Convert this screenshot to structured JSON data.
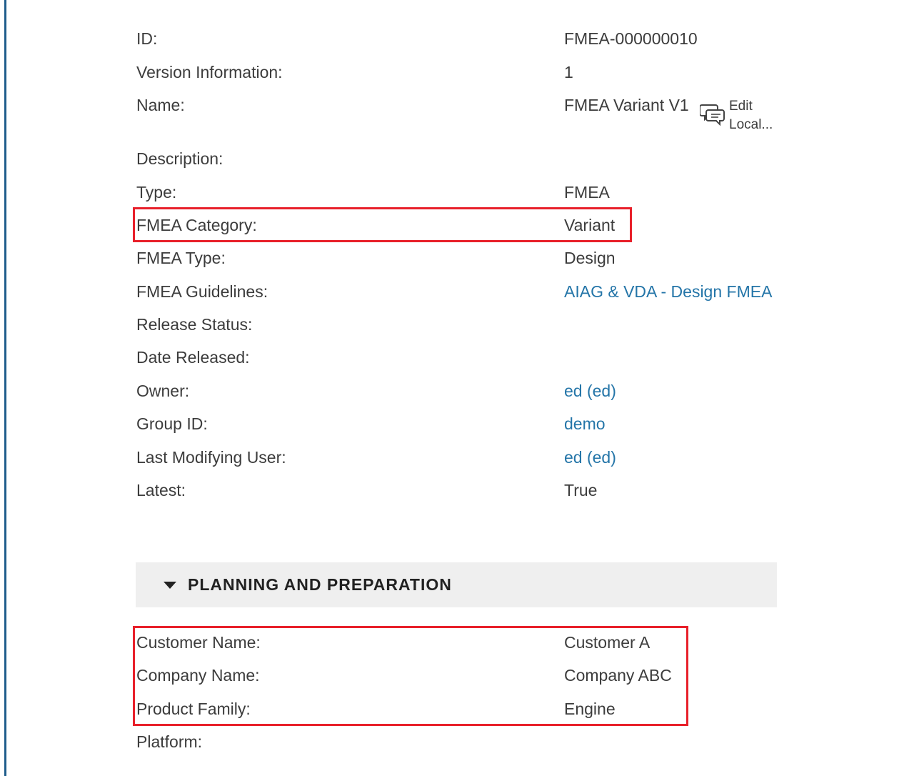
{
  "properties": [
    {
      "label": "ID:",
      "value": "FMEA-000000010",
      "link": false
    },
    {
      "label": "Version Information:",
      "value": "1",
      "link": false
    },
    {
      "label": "Name:",
      "value": "FMEA Variant V1",
      "link": false
    },
    {
      "label": "Description:",
      "value": "",
      "link": false
    },
    {
      "label": "Type:",
      "value": "FMEA",
      "link": false
    },
    {
      "label": "FMEA Category:",
      "value": "Variant",
      "link": false
    },
    {
      "label": "FMEA Type:",
      "value": "Design",
      "link": false
    },
    {
      "label": "FMEA Guidelines:",
      "value": "AIAG & VDA - Design FMEA",
      "link": true
    },
    {
      "label": "Release Status:",
      "value": "",
      "link": false
    },
    {
      "label": "Date Released:",
      "value": "",
      "link": false
    },
    {
      "label": "Owner:",
      "value": "ed (ed)",
      "link": true
    },
    {
      "label": "Group ID:",
      "value": "demo",
      "link": true
    },
    {
      "label": "Last Modifying User:",
      "value": "ed (ed)",
      "link": true
    },
    {
      "label": "Latest:",
      "value": "True",
      "link": false
    }
  ],
  "edit_local": {
    "line1": "Edit",
    "line2": "Local...",
    "icon": "speech-bubbles-icon"
  },
  "planning": {
    "title": "PLANNING AND PREPARATION",
    "toggle_icon": "caret-down-icon",
    "fields": [
      {
        "label": "Customer Name:",
        "value": "Customer A"
      },
      {
        "label": "Company Name:",
        "value": "Company ABC"
      },
      {
        "label": "Product Family:",
        "value": "Engine"
      },
      {
        "label": "Platform:",
        "value": ""
      }
    ]
  },
  "colors": {
    "link": "#2475a8",
    "highlight": "#e8202a",
    "section_bg": "#efefef",
    "left_rule": "#1f5d8c"
  }
}
